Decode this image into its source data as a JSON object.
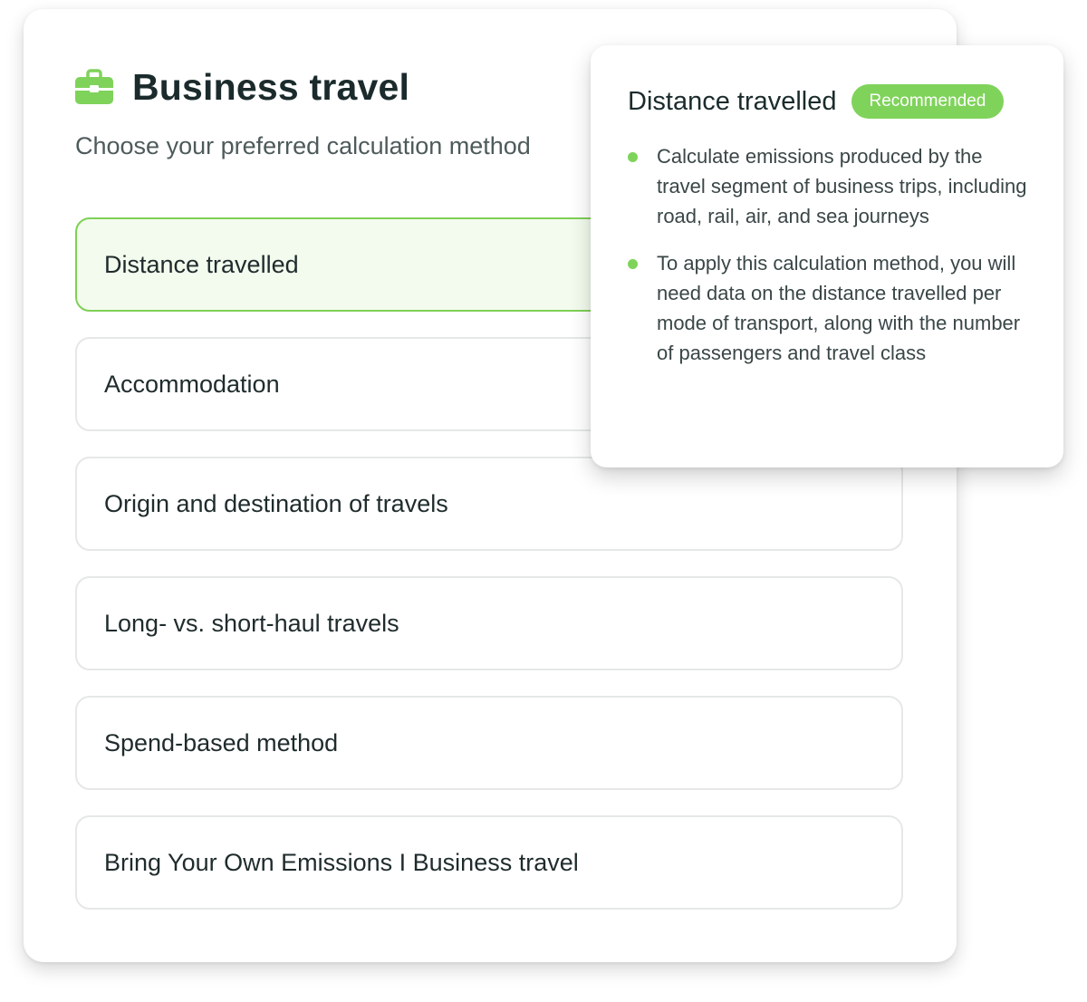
{
  "colors": {
    "accent_green": "#7fd35a",
    "selected_border": "#7ed056",
    "text_dark": "#1b2b2c"
  },
  "header": {
    "icon": "briefcase-icon",
    "title": "Business travel",
    "subtitle": "Choose your preferred calculation method"
  },
  "options": [
    {
      "label": "Distance travelled",
      "selected": true
    },
    {
      "label": "Accommodation",
      "selected": false
    },
    {
      "label": "Origin and destination of travels",
      "selected": false
    },
    {
      "label": "Long- vs. short-haul travels",
      "selected": false
    },
    {
      "label": "Spend-based method",
      "selected": false
    },
    {
      "label": "Bring Your Own Emissions I Business travel",
      "selected": false
    }
  ],
  "popover": {
    "title": "Distance travelled",
    "badge": "Recommended",
    "bullets": [
      "Calculate emissions produced by the travel segment of business trips, including road, rail, air, and sea journeys",
      "To apply this calculation method, you will need data on the distance travelled per mode of transport, along with the number of passengers and travel class"
    ]
  }
}
